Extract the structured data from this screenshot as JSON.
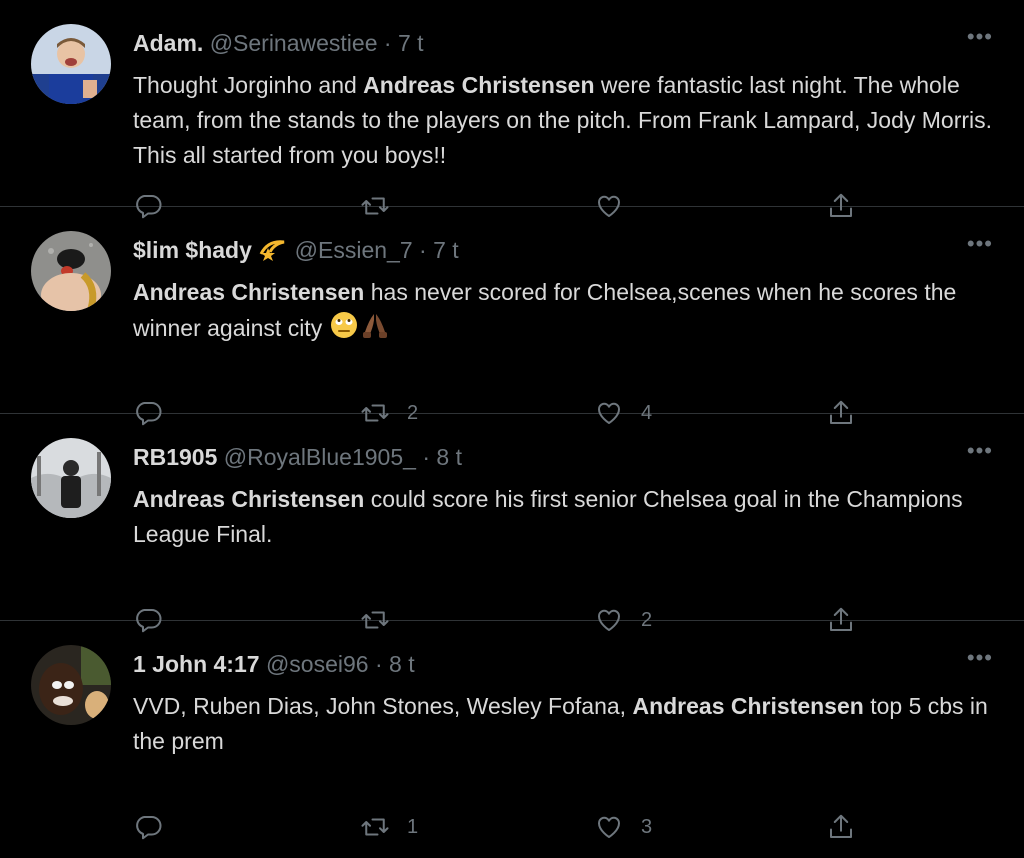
{
  "tweets": [
    {
      "name": "Adam.",
      "handle": "@Serinawestiee",
      "sep": "·",
      "time": "7 t",
      "more": "•••",
      "segments": [
        {
          "t": "Thought Jorginho and ",
          "b": false
        },
        {
          "t": "Andreas Christensen",
          "b": true
        },
        {
          "t": " were fantastic last night. The whole team, from the stands to the players on the pitch. From Frank Lampard, Jody Morris. This all started from you boys!!",
          "b": false
        }
      ],
      "retweets": "",
      "likes": ""
    },
    {
      "name": "$lim $hady",
      "name_emoji": "dizzy-star",
      "handle": "@Essien_7",
      "sep": "·",
      "time": "7 t",
      "more": "•••",
      "segments": [
        {
          "t": "Andreas Christensen",
          "b": true
        },
        {
          "t": " has never scored for Chelsea,scenes when he scores the winner against city ",
          "b": false
        }
      ],
      "trailing_emoji": [
        "eye-roll-face",
        "folded-hands"
      ],
      "retweets": "2",
      "likes": "4"
    },
    {
      "name": "RB1905",
      "handle": "@RoyalBlue1905_",
      "sep": "·",
      "time": "8 t",
      "more": "•••",
      "segments": [
        {
          "t": "Andreas Christensen",
          "b": true
        },
        {
          "t": " could score his first senior Chelsea goal in the Champions League Final.",
          "b": false
        }
      ],
      "retweets": "",
      "likes": "2"
    },
    {
      "name": "1 John 4:17",
      "handle": "@sosei96",
      "sep": "·",
      "time": "8 t",
      "more": "•••",
      "segments": [
        {
          "t": "VVD, Ruben Dias, John Stones, Wesley Fofana, ",
          "b": false
        },
        {
          "t": "Andreas Christensen",
          "b": true
        },
        {
          "t": " top 5 cbs in the prem",
          "b": false
        }
      ],
      "retweets": "1",
      "likes": "3"
    }
  ],
  "colors": {
    "background": "#000000",
    "text": "#d9d9d9",
    "muted": "#6e767d",
    "divider": "#2f3336"
  }
}
